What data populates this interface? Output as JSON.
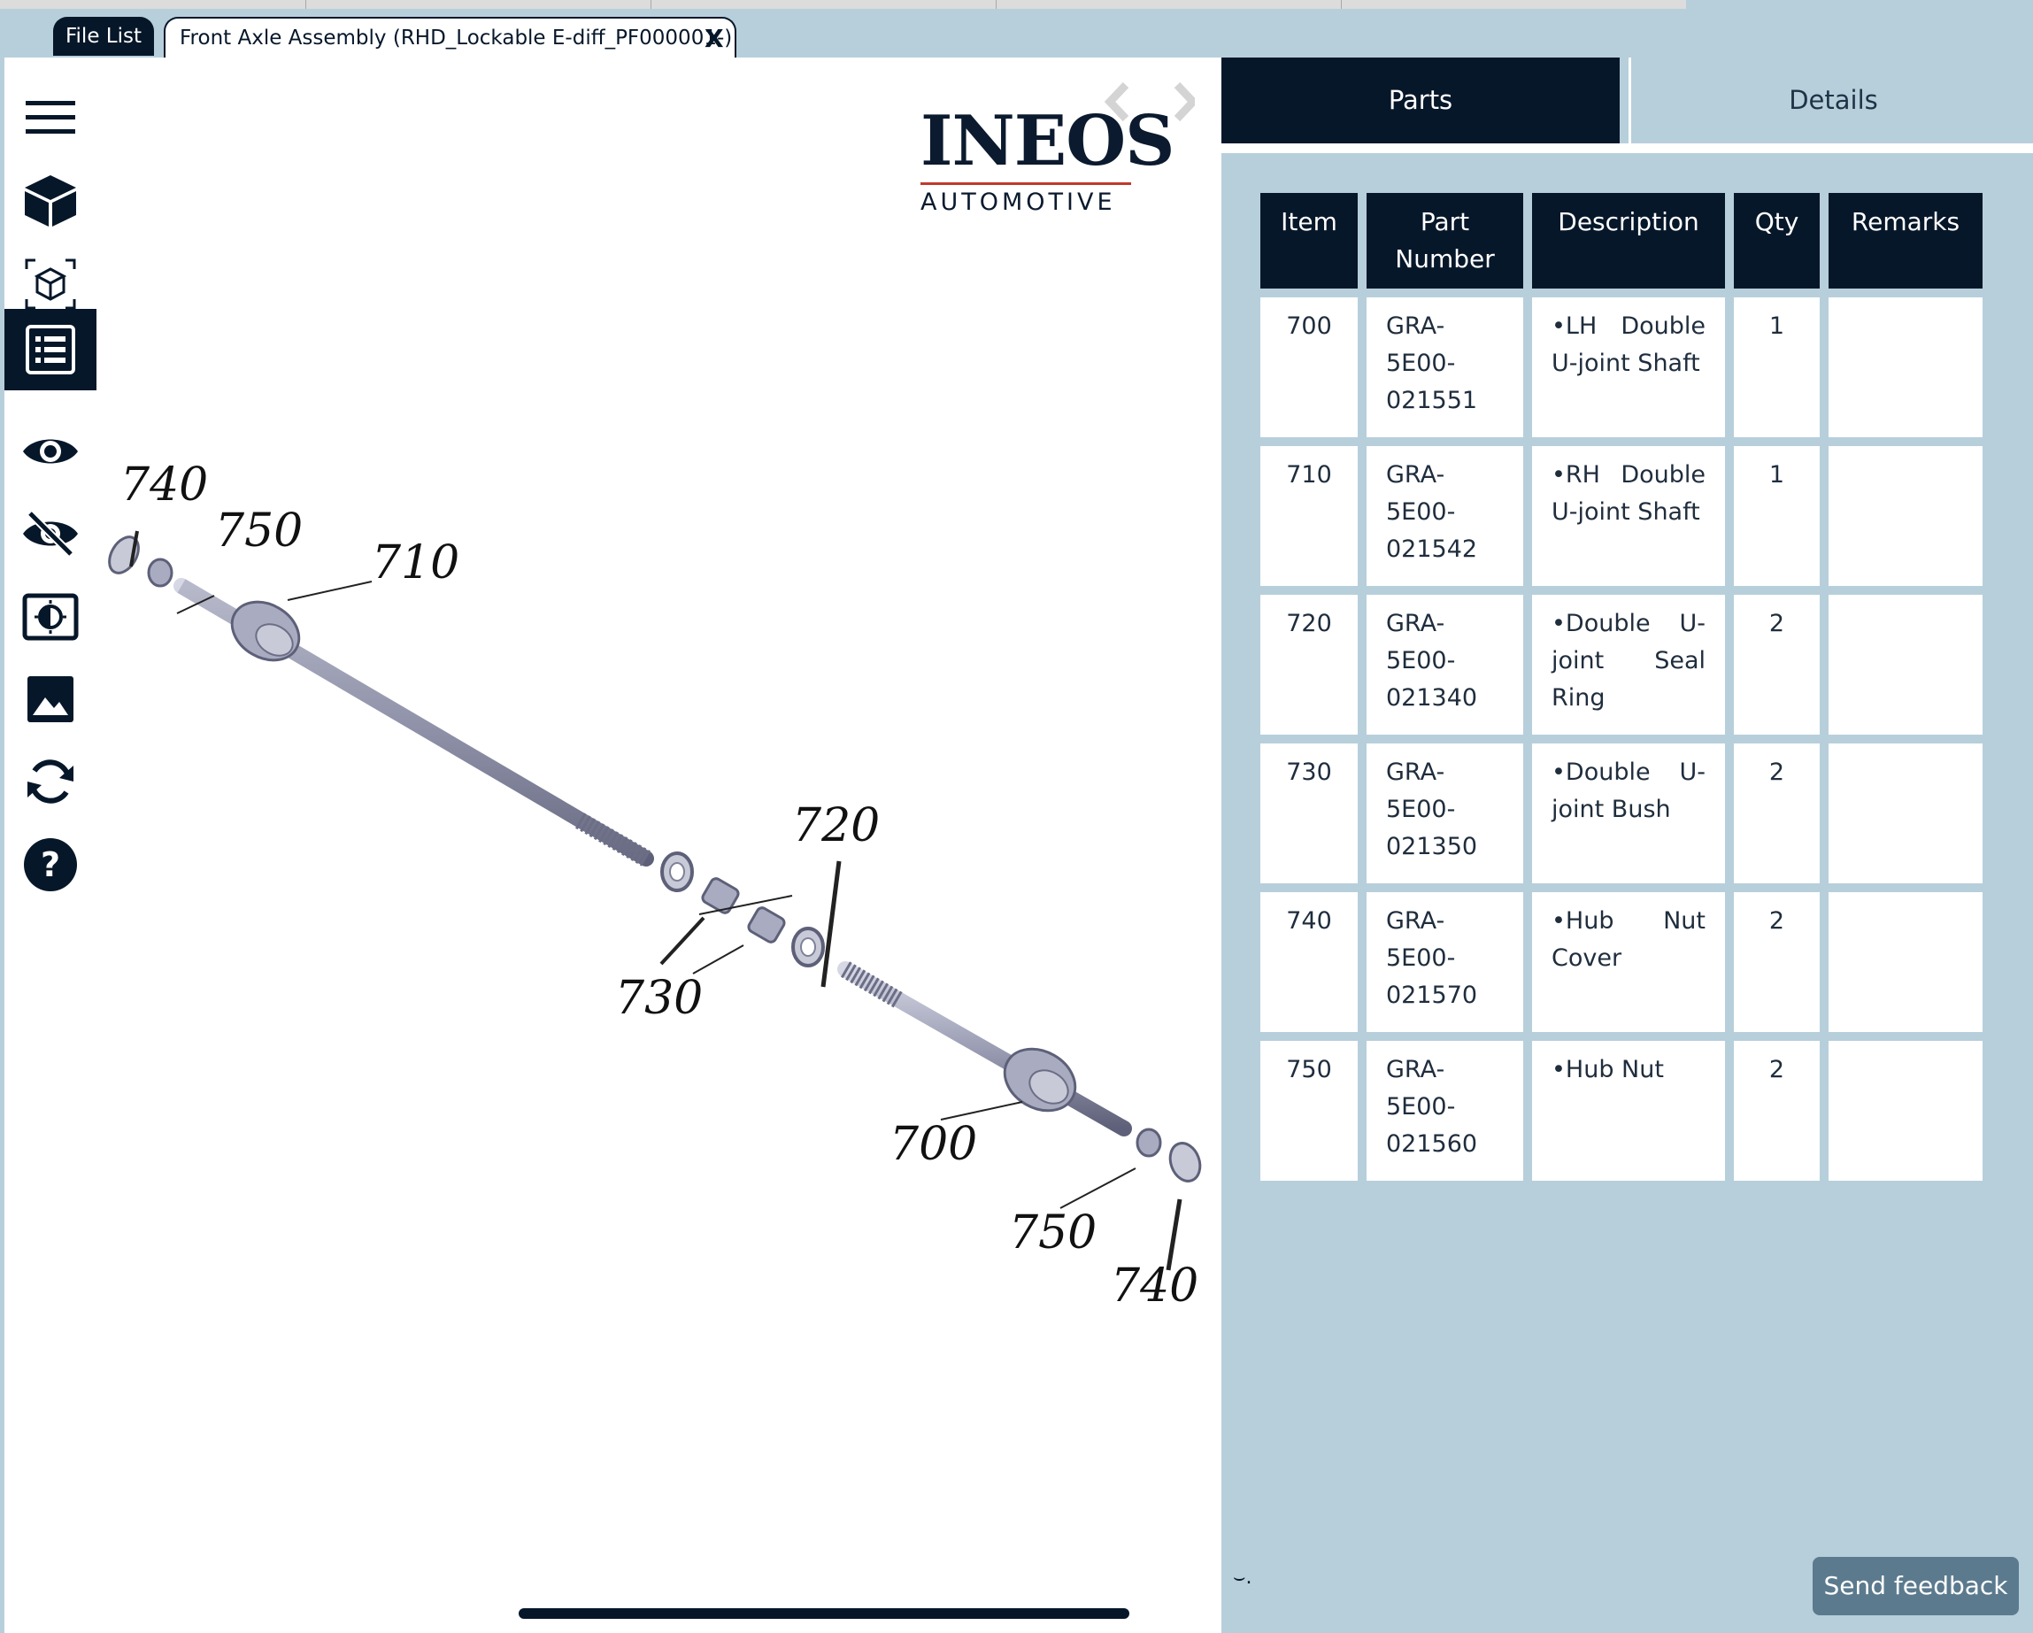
{
  "tabs": {
    "file_list": "File List",
    "document": "Front Axle Assembly (RHD_Lockable E-diff_PF000001-)",
    "close": "X"
  },
  "toolbar": {
    "items": [
      {
        "icon": "menu-icon"
      },
      {
        "icon": "cube-icon"
      },
      {
        "icon": "cube-frame-icon"
      },
      {
        "icon": "parts-list-icon",
        "active": true
      },
      {
        "icon": "eye-icon"
      },
      {
        "icon": "eye-off-icon"
      },
      {
        "icon": "contrast-icon"
      },
      {
        "icon": "image-icon"
      },
      {
        "icon": "refresh-icon"
      },
      {
        "icon": "help-icon"
      }
    ]
  },
  "logo": {
    "main": "INEOS",
    "sub": "AUTOMOTIVE"
  },
  "drawing": {
    "callouts": [
      "740",
      "750",
      "710",
      "720",
      "730",
      "700",
      "750",
      "740"
    ]
  },
  "panel_tabs": {
    "parts": "Parts",
    "details": "Details"
  },
  "parts_table": {
    "headers": {
      "item": "Item",
      "part_number": "Part Number",
      "description": "Description",
      "qty": "Qty",
      "remarks": "Remarks"
    },
    "rows": [
      {
        "item": "700",
        "part_number": "GRA-5E00-021551",
        "description": "•LH Double U-joint Shaft",
        "qty": "1",
        "remarks": ""
      },
      {
        "item": "710",
        "part_number": "GRA-5E00-021542",
        "description": "•RH Double U-joint Shaft",
        "qty": "1",
        "remarks": ""
      },
      {
        "item": "720",
        "part_number": "GRA-5E00-021340",
        "description": "•Double U-joint Seal Ring",
        "qty": "2",
        "remarks": ""
      },
      {
        "item": "730",
        "part_number": "GRA-5E00-021350",
        "description": "•Double U-joint Bush",
        "qty": "2",
        "remarks": ""
      },
      {
        "item": "740",
        "part_number": "GRA-5E00-021570",
        "description": "•Hub Nut Cover",
        "qty": "2",
        "remarks": ""
      },
      {
        "item": "750",
        "part_number": "GRA-5E00-021560",
        "description": "•Hub Nut",
        "qty": "2",
        "remarks": ""
      }
    ]
  },
  "feedback": "Send feedback",
  "colors": {
    "navy": "#07172a",
    "panel": "#b7cfdb",
    "feedback": "#5b7a8e",
    "logo_accent": "#c0392b"
  }
}
